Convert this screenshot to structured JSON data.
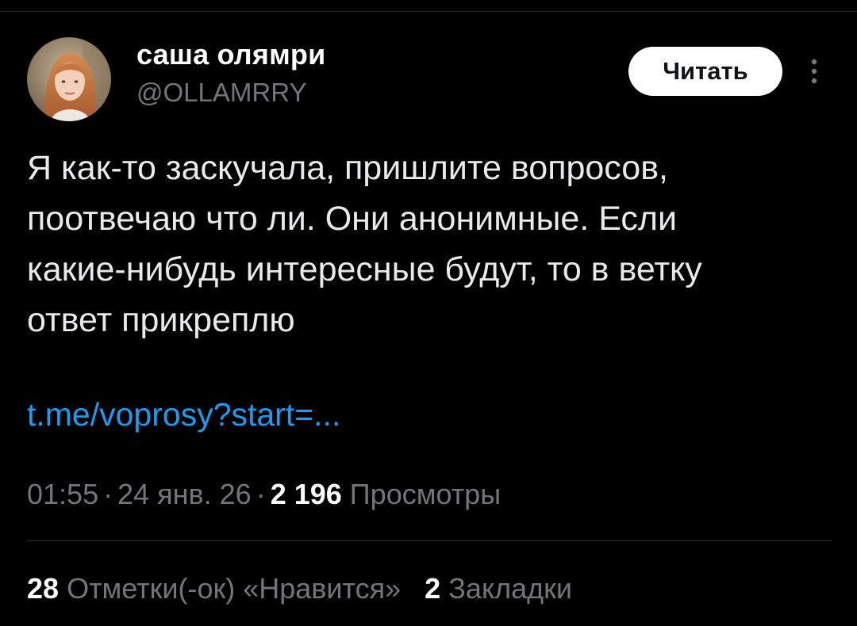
{
  "author": {
    "name": "саша олямри",
    "handle": "@OLLAMRRY",
    "avatar_icon": "user-avatar-photo"
  },
  "follow_button": {
    "label": "Читать"
  },
  "more_menu": {
    "icon": "vertical-dots-icon"
  },
  "tweet": {
    "lines": [
      "Я как-то заскучала, пришлите вопросов,",
      "поотвечаю что ли. Они анонимные. Если",
      "какие-нибудь интересные будут, то в ветку",
      "ответ прикреплю"
    ],
    "link": "t.me/voprosy?start=..."
  },
  "meta": {
    "time": "01:55",
    "date": "24 янв. 26",
    "separator": "·",
    "views_count": "2 196",
    "views_label": "Просмотры"
  },
  "stats": {
    "likes_count": "28",
    "likes_label": "Отметки(-ок) «Нравится»",
    "bookmarks_count": "2",
    "bookmarks_label": "Закладки"
  },
  "colors": {
    "background": "#000000",
    "text_primary": "#e7e9ea",
    "text_secondary": "#71767b",
    "link": "#1d9bf0",
    "button_bg": "#ffffff",
    "button_text": "#0f1419",
    "divider": "#2f3336"
  }
}
